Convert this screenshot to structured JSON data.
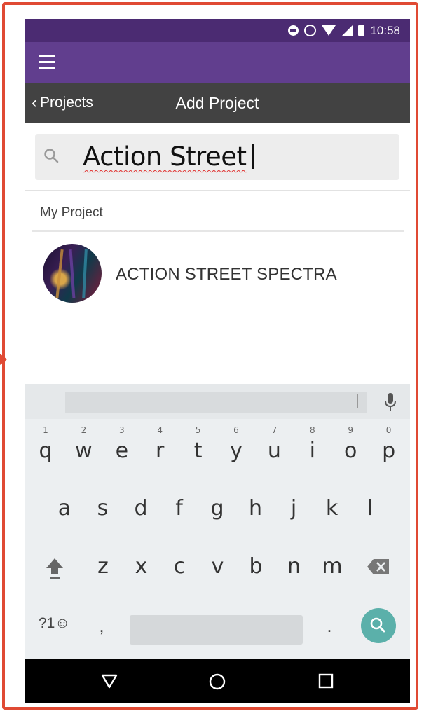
{
  "status_bar": {
    "time": "10:58",
    "icons": [
      "do-not-disturb-icon",
      "alarm-icon",
      "wifi-icon",
      "signal-icon",
      "battery-icon"
    ]
  },
  "app_bar": {
    "menu_icon": "hamburger-menu-icon"
  },
  "nav_bar": {
    "back_label": "Projects",
    "title": "Add Project"
  },
  "search": {
    "value": "Action Street",
    "icon": "search-icon"
  },
  "results": {
    "section_label": "My Project",
    "items": [
      {
        "name": "ACTION STREET SPECTRA",
        "avatar": "project-thumbnail"
      }
    ]
  },
  "keyboard": {
    "row1": [
      {
        "key": "q",
        "hint": "1"
      },
      {
        "key": "w",
        "hint": "2"
      },
      {
        "key": "e",
        "hint": "3"
      },
      {
        "key": "r",
        "hint": "4"
      },
      {
        "key": "t",
        "hint": "5"
      },
      {
        "key": "y",
        "hint": "6"
      },
      {
        "key": "u",
        "hint": "7"
      },
      {
        "key": "i",
        "hint": "8"
      },
      {
        "key": "o",
        "hint": "9"
      },
      {
        "key": "p",
        "hint": "0"
      }
    ],
    "row2": [
      "a",
      "s",
      "d",
      "f",
      "g",
      "h",
      "j",
      "k",
      "l"
    ],
    "row3": [
      "z",
      "x",
      "c",
      "v",
      "b",
      "n",
      "m"
    ],
    "symbols_label": "?1☺",
    "comma": ",",
    "period": ".",
    "shift_icon": "shift-icon",
    "backspace_icon": "backspace-icon",
    "search_key_icon": "search-icon",
    "mic_icon": "microphone-icon"
  },
  "system_nav": [
    "back-triangle-icon",
    "home-circle-icon",
    "recents-square-icon"
  ],
  "colors": {
    "status_bar": "#4b2b72",
    "app_bar": "#613e8e",
    "nav_bar": "#424242",
    "frame": "#e04a34",
    "search_key": "#5bb0aa"
  }
}
